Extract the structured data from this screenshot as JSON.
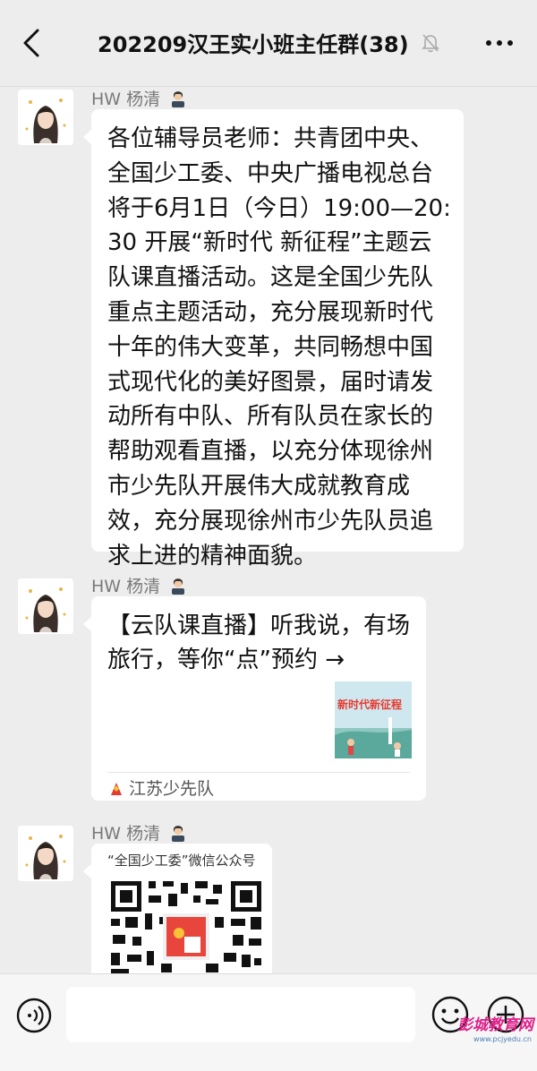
{
  "header": {
    "title": "202209汉王实小班主任群(38)",
    "back_icon": "chevron-left-icon",
    "mute_icon": "bell-muted-icon",
    "more_icon": "more-dots-icon"
  },
  "messages": [
    {
      "sender": "HW 杨清",
      "text": "各位辅导员老师：共青团中央、全国少工委、中央广播电视总台将于6月1日（今日）19:00—20:30 开展“新时代 新征程”主题云队课直播活动。这是全国少先队重点主题活动，充分展现新时代十年的伟大变革，共同畅想中国式现代化的美好图景，届时请发动所有中队、所有队员在家长的帮助观看直播，以充分体现徐州市少先队开展伟大成就教育成效，充分展现徐州市少先队员追求上进的精神面貌。"
    },
    {
      "sender": "HW 杨清",
      "card_title": "【云队课直播】听我说，有场旅行，等你“点”预约 →",
      "thumb_text": "新时代新征程",
      "source": "江苏少先队"
    },
    {
      "sender": "HW 杨清",
      "caption": "“全国少工委”微信公众号"
    }
  ],
  "footer": {
    "voice_icon": "voice-icon",
    "input_value": "",
    "emoji_icon": "emoji-icon",
    "plus_icon": "plus-icon"
  },
  "watermark": {
    "text": "彭城教育网",
    "url": "www.pcjyedu.cn"
  },
  "colors": {
    "background": "#ededed",
    "bubble": "#ffffff",
    "sender_name": "#7a7a7a",
    "watermark": "#e0208a"
  }
}
